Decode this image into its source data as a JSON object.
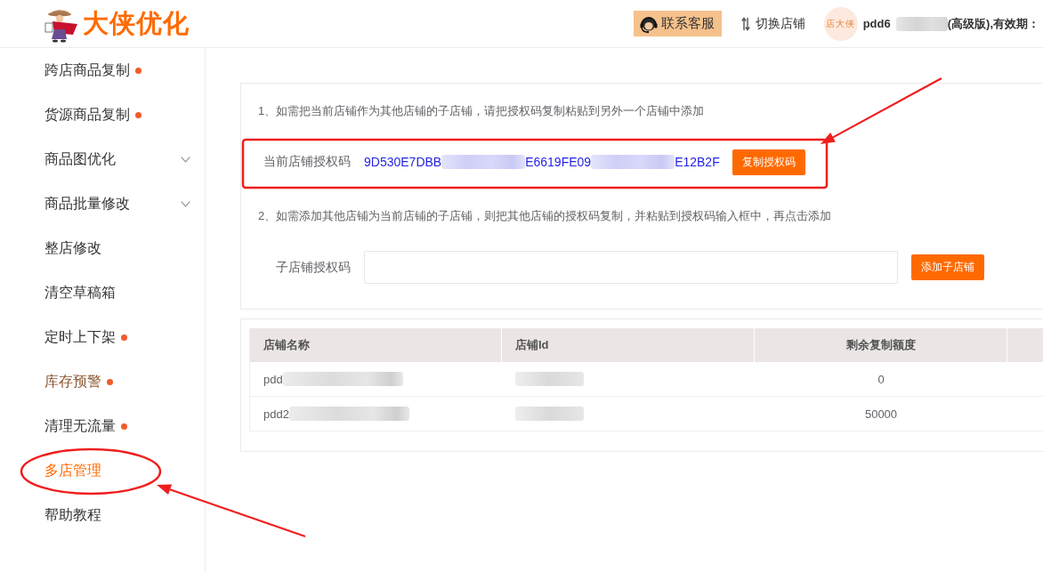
{
  "header": {
    "logo_text": "大侠优化",
    "service_button": "联系客服",
    "switch_shop": "切换店铺",
    "avatar_text": "店大侠",
    "account": [
      {
        "kind": "text",
        "text": "pdd6"
      },
      {
        "kind": "blur"
      },
      {
        "kind": "text",
        "text": "(高级版),有效期："
      }
    ]
  },
  "sidebar": {
    "items": [
      {
        "label": "跨店商品复制",
        "kind": "link",
        "dot": true,
        "selected": false,
        "hovered": false
      },
      {
        "label": "货源商品复制",
        "kind": "link",
        "dot": true,
        "selected": false,
        "hovered": false
      },
      {
        "label": "商品图优化",
        "kind": "submenu",
        "expanded": false,
        "dot": false,
        "selected": false,
        "hovered": false
      },
      {
        "label": "商品批量修改",
        "kind": "submenu",
        "expanded": false,
        "dot": false,
        "selected": false,
        "hovered": false
      },
      {
        "label": "整店修改",
        "kind": "link",
        "dot": false,
        "selected": false,
        "hovered": false
      },
      {
        "label": "清空草稿箱",
        "kind": "link",
        "dot": false,
        "selected": false,
        "hovered": false
      },
      {
        "label": "定时上下架",
        "kind": "link",
        "dot": true,
        "selected": false,
        "hovered": false
      },
      {
        "label": "库存预警",
        "kind": "link",
        "dot": true,
        "selected": false,
        "hovered": true
      },
      {
        "label": "清理无流量",
        "kind": "link",
        "dot": true,
        "selected": false,
        "hovered": false
      },
      {
        "label": "多店管理",
        "kind": "link",
        "dot": false,
        "selected": true,
        "hovered": false
      },
      {
        "label": "帮助教程",
        "kind": "link",
        "dot": false,
        "selected": false,
        "hovered": false
      }
    ]
  },
  "auth_panel": {
    "step_1": "1、如需把当前店铺作为其他店铺的子店铺，请把授权码复制粘贴到另外一个店铺中添加",
    "code_label": "当前店铺授权码",
    "code": [
      {
        "kind": "text",
        "text": "9D530E7DBB"
      },
      {
        "kind": "blur"
      },
      {
        "kind": "text",
        "text": "E6619FE09"
      },
      {
        "kind": "blur"
      },
      {
        "kind": "text",
        "text": "E12B2F"
      }
    ],
    "copy_button": "复制授权码",
    "step_2": "2、如需添加其他店铺为当前店铺的子店铺，则把其他店铺的授权码复制，并粘贴到授权码输入框中，再点击添加",
    "sub_label": "子店铺授权码",
    "add_button": "添加子店铺"
  },
  "table": {
    "columns": [
      "店铺名称",
      "店铺Id",
      "剩余复制额度"
    ],
    "rows": [
      {
        "name": [
          {
            "kind": "text",
            "text": "pdd"
          },
          {
            "kind": "blur"
          }
        ],
        "id": [
          {
            "kind": "blur"
          }
        ],
        "quota": "0"
      },
      {
        "name": [
          {
            "kind": "text",
            "text": "pdd2"
          },
          {
            "kind": "blur"
          }
        ],
        "id": [
          {
            "kind": "blur"
          }
        ],
        "quota": "50000"
      }
    ]
  },
  "annotations": [
    {
      "kind": "rectangle"
    },
    {
      "kind": "arrow"
    },
    {
      "kind": "ellipse"
    },
    {
      "kind": "arrow"
    }
  ]
}
